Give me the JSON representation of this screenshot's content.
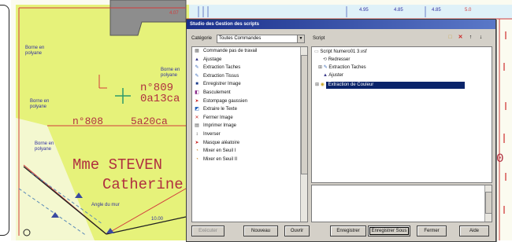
{
  "map": {
    "labels_big": [
      "n°809",
      "0a13ca",
      "n°808",
      "5a20ca",
      "Mme STEVEN",
      "Catherine",
      "0"
    ],
    "labels_small": [
      "Borne en polyane",
      "Borne en polyane",
      "Borne en polyane",
      "Borne en polyane",
      "Angle du mur",
      "10.00"
    ],
    "top_labels": [
      "4.07",
      "4.95",
      "4.85",
      "4.85",
      "5.0"
    ]
  },
  "dialog": {
    "title": "Studio des Gestion des scripts",
    "category_label": "Catégorie",
    "category_value": "Toutes Commandes",
    "script_label": "Script",
    "commands": [
      {
        "icon": "▦",
        "label": "Commande pas de travail"
      },
      {
        "icon": "▲",
        "label": "Ajustage"
      },
      {
        "icon": "✎",
        "label": "Extraction Taches"
      },
      {
        "icon": "✎",
        "label": "Extraction Tissus"
      },
      {
        "icon": "■",
        "label": "Enregistrer Image"
      },
      {
        "icon": "◧",
        "label": "Basculement"
      },
      {
        "icon": "➤",
        "label": "Estompage gaussien"
      },
      {
        "icon": "◩",
        "label": "Extraire le Texte"
      },
      {
        "icon": "✕",
        "label": "Fermer Image"
      },
      {
        "icon": "▤",
        "label": "Imprimer Image"
      },
      {
        "icon": "↕",
        "label": "Inverser"
      },
      {
        "icon": "➤",
        "label": "Masque aléatoire"
      },
      {
        "icon": "◔",
        "label": "Mixer en Seuil I"
      },
      {
        "icon": "◔",
        "label": "Mixer en Seuil II"
      }
    ],
    "tree": {
      "root": "Script Numero01 3.vsf",
      "children": [
        "Redresser",
        "Extraction Taches",
        "Ajuster",
        "Extraction de Couleur"
      ]
    },
    "buttons": [
      "Exécuter",
      "Nouveau",
      "Ouvrir",
      "Enregistrer",
      "Enregistrer Sous",
      "Fermer",
      "Aide"
    ]
  }
}
